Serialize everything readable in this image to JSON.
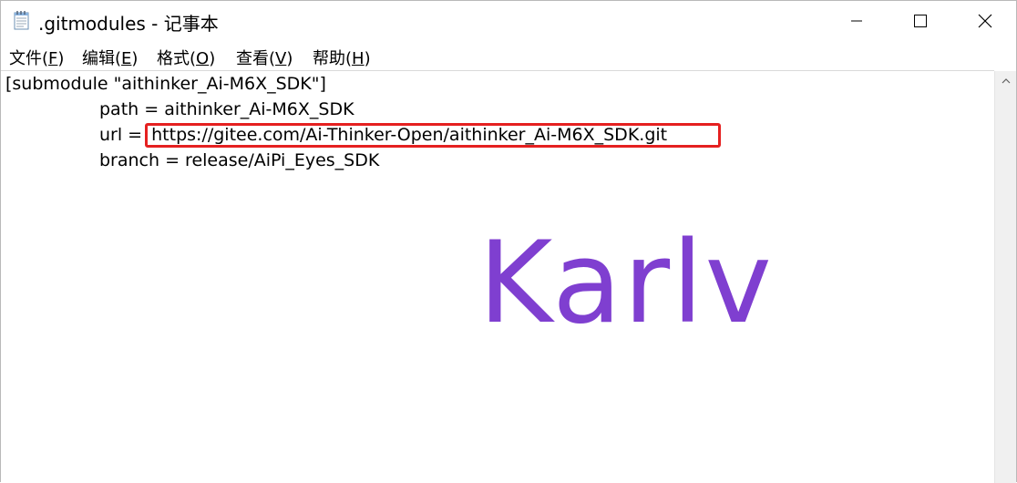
{
  "window": {
    "title": ".gitmodules - 记事本",
    "icon": "notepad-icon",
    "controls": [
      "minimize-icon",
      "maximize-icon",
      "close-icon"
    ]
  },
  "menu": {
    "items": [
      {
        "pre": "文件(",
        "key": "F",
        "post": ")"
      },
      {
        "pre": "编辑(",
        "key": "E",
        "post": ")"
      },
      {
        "pre": "格式(",
        "key": "O",
        "post": ")"
      },
      {
        "pre": "查看(",
        "key": "V",
        "post": ")"
      },
      {
        "pre": "帮助(",
        "key": "H",
        "post": ")"
      }
    ]
  },
  "editor": {
    "line1": "[submodule \"aithinker_Ai-M6X_SDK\"]",
    "line2": "path = aithinker_Ai-M6X_SDK",
    "line3_prefix": "url = ",
    "line3_url": "https://gitee.com/Ai-Thinker-Open/aithinker_Ai-M6X_SDK.git",
    "line4": "branch = release/AiPi_Eyes_SDK"
  },
  "highlight_color": "#e52020",
  "watermark": {
    "text": "Karlv",
    "color": "#7f3fd0"
  }
}
